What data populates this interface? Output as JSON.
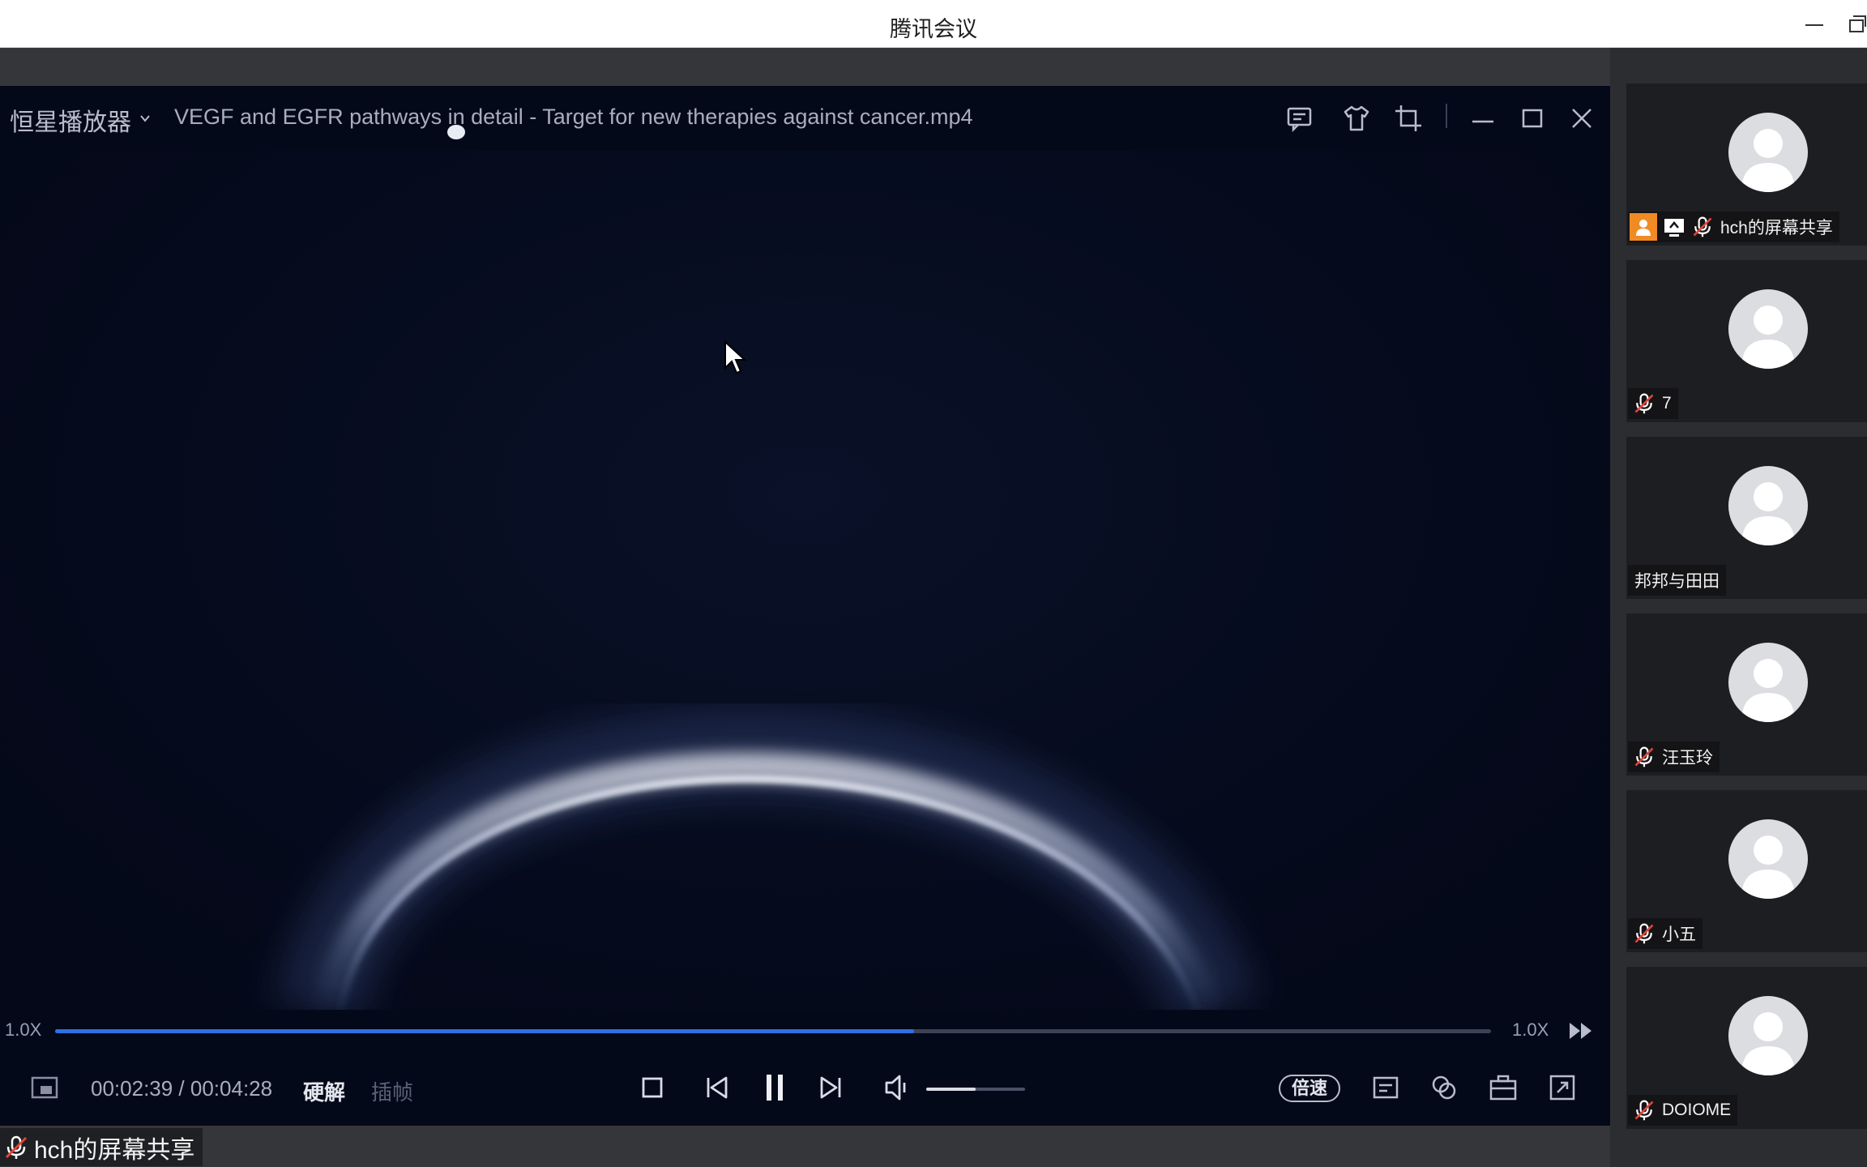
{
  "window": {
    "title": "腾讯会议"
  },
  "player": {
    "brand": "恒星播放器",
    "file_title": "VEGF and EGFR pathways in detail - Target for new therapies against cancer.mp4",
    "speed_left": "1.0X",
    "speed_right": "1.0X",
    "progress_fraction": 0.598,
    "current_time": "00:02:39",
    "total_time": "00:04:28",
    "time_display": "00:02:39 / 00:04:28",
    "hw_decode_label": "硬解",
    "frame_interp_label": "插帧",
    "speed_button_label": "倍速",
    "volume_fraction": 0.5
  },
  "share_label": {
    "text": "hch的屏幕共享"
  },
  "participants": [
    {
      "name": "hch的屏幕共享",
      "muted": true,
      "host": true,
      "sharing": true
    },
    {
      "name": "7",
      "muted": true
    },
    {
      "name": "邦邦与田田",
      "muted": false
    },
    {
      "name": "汪玉玲",
      "muted": true
    },
    {
      "name": "小五",
      "muted": true
    },
    {
      "name": "DOIOME",
      "muted": true
    }
  ],
  "colors": {
    "progress": "#2f6ee6",
    "video_bg": "#040919",
    "host_badge": "#f08a24"
  },
  "icons": [
    "chat-icon",
    "skin-icon",
    "crop-icon",
    "minimize-icon",
    "maximize-icon",
    "close-icon",
    "stop-icon",
    "previous-icon",
    "pause-icon",
    "next-icon",
    "volume-icon",
    "subtitle-icon",
    "link-icon",
    "toolbox-icon",
    "fullscreen-icon",
    "mic-off-icon"
  ]
}
